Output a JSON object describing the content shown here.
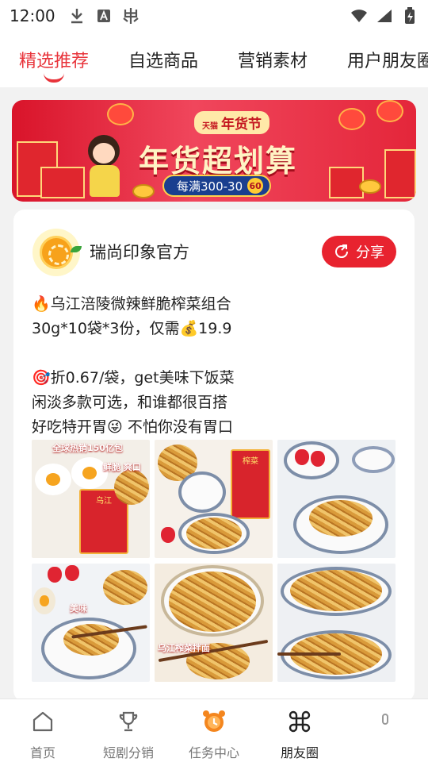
{
  "status_bar": {
    "time": "12:00",
    "icons_left": [
      "download-icon",
      "a-icon",
      "app-icon"
    ],
    "icons_right": [
      "wifi-icon",
      "signal-icon",
      "battery-icon"
    ]
  },
  "tabs": [
    {
      "label": "精选推荐",
      "active": true
    },
    {
      "label": "自选商品",
      "active": false
    },
    {
      "label": "营销素材",
      "active": false
    },
    {
      "label": "用户朋友圈",
      "active": false
    }
  ],
  "banner": {
    "badge": "年货节",
    "badge_prefix": "天猫",
    "title": "年货超划算",
    "promo": "每满300-30",
    "promo_badge": "60"
  },
  "post": {
    "store_name": "瑞尚印象官方",
    "share_label": "分享",
    "text": "🔥乌江涪陵微辣鲜脆榨菜组合\n30g*10袋*3份，仅需💰19.9\n\n🎯折0.67/袋，get美味下饭菜\n闲淡多款可选，和谁都很百搭\n好吃特开胃😜 不怕你没有胃口",
    "photo_captions": [
      "全球热销150亿包",
      "鲜脆 爽口",
      "美味",
      "乌江榨菜拌面"
    ]
  },
  "bottom_nav": [
    {
      "label": "首页",
      "icon": "home-icon",
      "active": false
    },
    {
      "label": "短剧分销",
      "icon": "trophy-icon",
      "active": false
    },
    {
      "label": "任务中心",
      "icon": "alarm-clock-icon",
      "active": false
    },
    {
      "label": "朋友圈",
      "icon": "command-icon",
      "active": true
    },
    {
      "label": "",
      "icon": "lock-icon",
      "active": false
    }
  ],
  "colors": {
    "accent": "#e8333a",
    "share_button": "#e8232f",
    "background": "#f2f2f2"
  }
}
